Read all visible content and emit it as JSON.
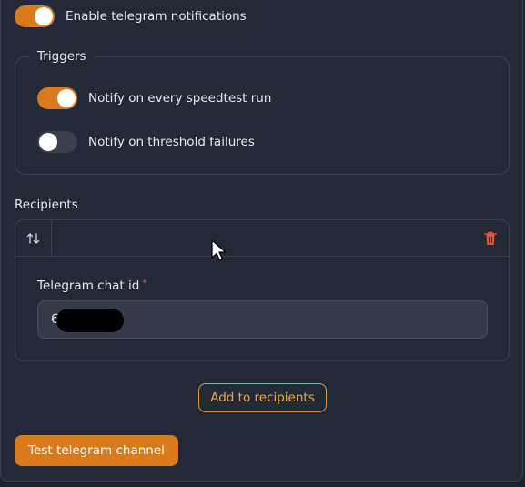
{
  "enable": {
    "label": "Enable telegram notifications",
    "on": true
  },
  "triggers": {
    "legend": "Triggers",
    "items": [
      {
        "label": "Notify on every speedtest run",
        "on": true
      },
      {
        "label": "Notify on threshold failures",
        "on": false
      }
    ]
  },
  "recipients": {
    "label": "Recipients",
    "field_label": "Telegram chat id",
    "required_mark": "*",
    "chat_id_visible": "6         7",
    "add_button": "Add to recipients"
  },
  "test_button": "Test telegram channel",
  "colors": {
    "accent": "#d97a1c",
    "danger": "#e0533d",
    "background": "#242a35"
  },
  "icons": {
    "reorder": "reorder-arrows-icon",
    "delete": "trash-icon",
    "pointer": "mouse-cursor-icon"
  }
}
